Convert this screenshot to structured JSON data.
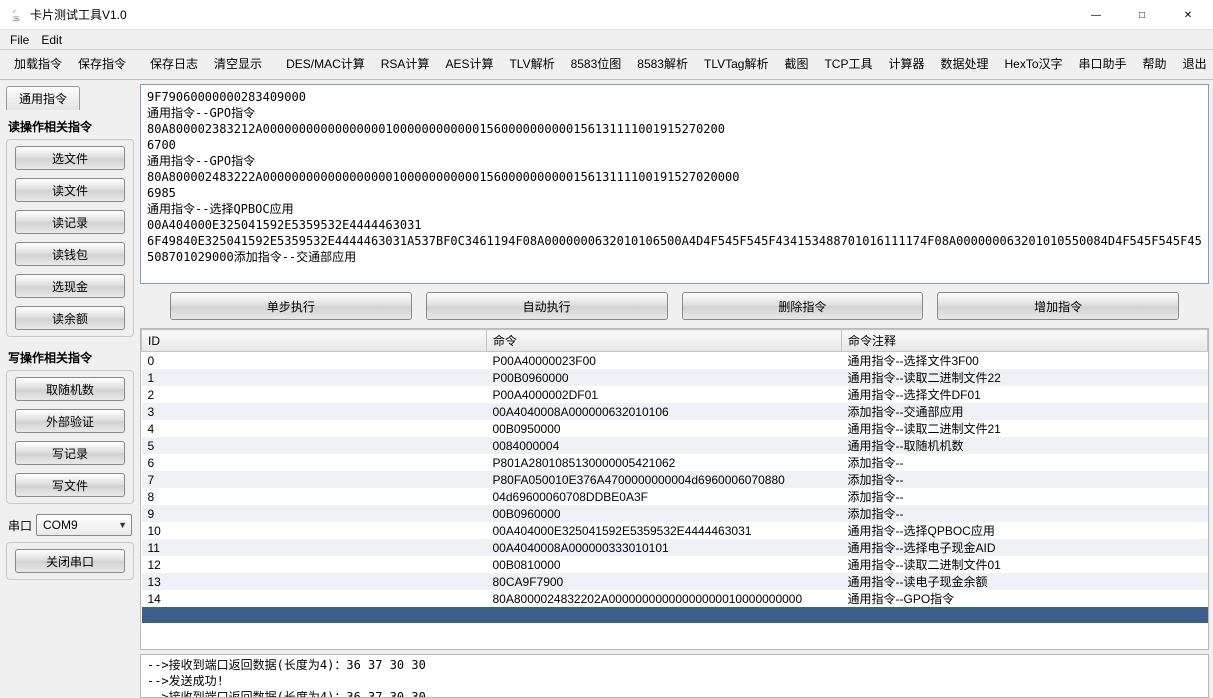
{
  "window": {
    "title": "卡片测试工具V1.0"
  },
  "menu": {
    "file": "File",
    "edit": "Edit"
  },
  "toolbar": {
    "load": "加载指令",
    "save": "保存指令",
    "savelog": "保存日志",
    "clear": "清空显示",
    "desmac": "DES/MAC计算",
    "rsa": "RSA计算",
    "aes": "AES计算",
    "tlv": "TLV解析",
    "bitmap": "8583位图",
    "parse8583": "8583解析",
    "tlvtag": "TLVTag解析",
    "shot": "截图",
    "tcp": "TCP工具",
    "calc": "计算器",
    "dataproc": "数据处理",
    "hexhan": "HexTo汉字",
    "serialhelper": "串口助手",
    "help": "帮助",
    "exit": "退出"
  },
  "sidebar": {
    "tab": "通用指令",
    "readTitle": "读操作相关指令",
    "read": {
      "selectFile": "选文件",
      "readFile": "读文件",
      "readRecord": "读记录",
      "readWallet": "读钱包",
      "selectCash": "选现金",
      "readBalance": "读余额"
    },
    "writeTitle": "写操作相关指令",
    "write": {
      "random": "取随机数",
      "extAuth": "外部验证",
      "writeRecord": "写记录",
      "writeFile": "写文件"
    },
    "portLabel": "串口",
    "portValue": "COM9",
    "closePort": "关闭串口"
  },
  "log": [
    "9F79060000000283409000",
    "通用指令--GPO指令",
    "80A800002383212A0000000000000000010000000000001560000000000156131111001915270200",
    "6700",
    "通用指令--GPO指令",
    "80A800002483222A000000000000000000100000000000156000000000015613111100191527020000",
    "6985",
    "通用指令--选择QPBOC应用",
    "00A404000E325041592E5359532E4444463031",
    "6F49840E325041592E5359532E4444463031A537BF0C3461194F08A0000000632010106500A4D4F545F545F434153488701016111174F08A000000063201010550084D4F545F545F45508701029000添加指令--交通部应用"
  ],
  "actions": {
    "step": "单步执行",
    "auto": "自动执行",
    "delete": "删除指令",
    "add": "增加指令"
  },
  "table": {
    "headers": {
      "id": "ID",
      "cmd": "命令",
      "note": "命令注释"
    },
    "rows": [
      {
        "id": "0",
        "cmd": "P00A40000023F00",
        "note": "通用指令--选择文件3F00"
      },
      {
        "id": "1",
        "cmd": "P00B0960000",
        "note": "通用指令--读取二进制文件22"
      },
      {
        "id": "2",
        "cmd": "P00A4000002DF01",
        "note": "通用指令--选择文件DF01"
      },
      {
        "id": "3",
        "cmd": "00A4040008A000000632010106",
        "note": "添加指令--交通部应用"
      },
      {
        "id": "4",
        "cmd": "00B0950000",
        "note": "通用指令--读取二进制文件21"
      },
      {
        "id": "5",
        "cmd": "0084000004",
        "note": "通用指令--取随机机数"
      },
      {
        "id": "6",
        "cmd": "P801A2801085130000005421062",
        "note": "添加指令--"
      },
      {
        "id": "7",
        "cmd": "P80FA050010E376A4700000000004d6960006070880",
        "note": "添加指令--"
      },
      {
        "id": "8",
        "cmd": "04d69600060708DDBE0A3F",
        "note": "添加指令--"
      },
      {
        "id": "9",
        "cmd": "00B0960000",
        "note": "添加指令--"
      },
      {
        "id": "10",
        "cmd": "00A404000E325041592E5359532E4444463031",
        "note": "通用指令--选择QPBOC应用"
      },
      {
        "id": "11",
        "cmd": "00A4040008A000000333010101",
        "note": "通用指令--选择电子现金AID"
      },
      {
        "id": "12",
        "cmd": "00B0810000",
        "note": "通用指令--读取二进制文件01"
      },
      {
        "id": "13",
        "cmd": "80CA9F7900",
        "note": "通用指令--读电子现金余额"
      },
      {
        "id": "14",
        "cmd": "80A8000024832202A00000000000000000010000000000",
        "note": "通用指令--GPO指令"
      }
    ],
    "selected": 15
  },
  "bottomLog": [
    "-->接收到端口返回数据(长度为4)：36 37 30 30",
    "-->发送成功!",
    "-->接收到端口返回数据(长度为4)：36 37 30 30"
  ]
}
